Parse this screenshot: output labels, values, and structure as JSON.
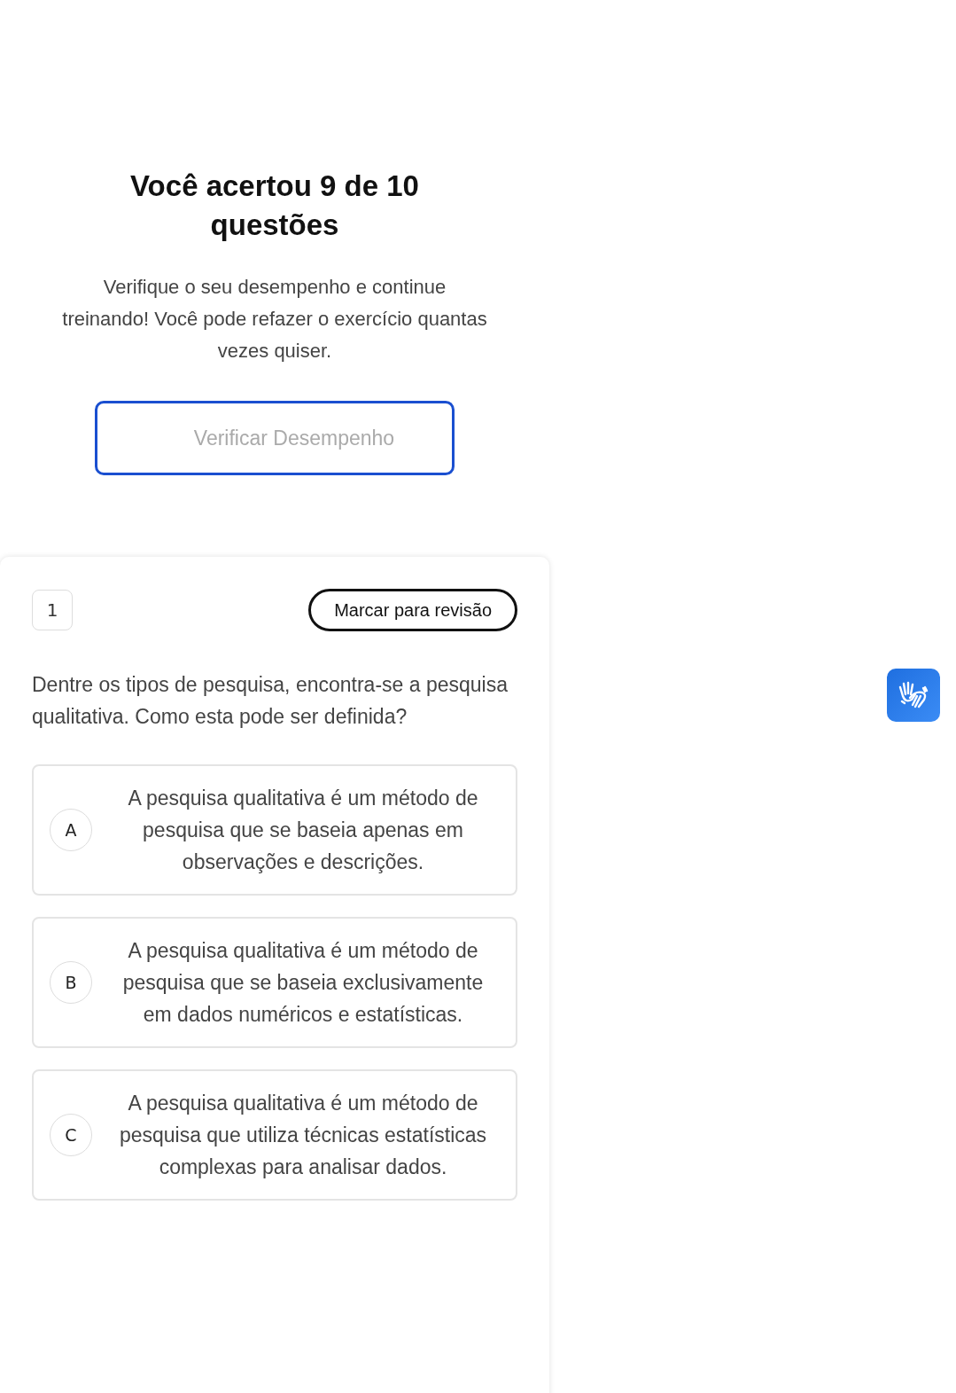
{
  "result": {
    "title": "Você acertou 9 de 10 questões",
    "description": "Verifique o seu desempenho e continue treinando! Você pode refazer o exercício quantas vezes quiser.",
    "button": "Verificar Desempenho"
  },
  "question": {
    "number": "1",
    "review_button": "Marcar para revisão",
    "text": "Dentre os tipos de pesquisa, encontra-se a pesquisa qualitativa. Como esta pode ser definida?",
    "options": [
      {
        "letter": "A",
        "text": "A pesquisa qualitativa é um método de pesquisa que se baseia apenas em observações e descrições.",
        "selected": false
      },
      {
        "letter": "B",
        "text": "A pesquisa qualitativa é um método de pesquisa que se baseia exclusivamente em dados numéricos e estatísticas.",
        "selected": false
      },
      {
        "letter": "C",
        "text": "A pesquisa qualitativa é um método de pesquisa que utiliza técnicas estatísticas complexas para analisar dados.",
        "selected": false
      }
    ]
  }
}
